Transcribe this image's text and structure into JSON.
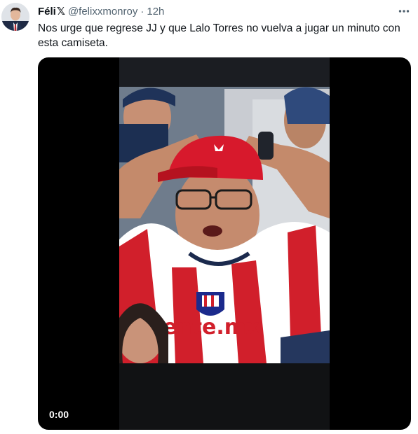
{
  "tweet": {
    "author_name": "Féli",
    "author_badge": "𝕏",
    "handle": "@felixxmonroy",
    "separator": "·",
    "time": "12h",
    "text": "Nos urge que regrese JJ y que Lalo Torres no vuelva a jugar un minuto con esta camiseta.",
    "more_icon": "more-horizontal-icon"
  },
  "video": {
    "timestamp": "0:00",
    "shirt_sponsor": "ente.mx"
  },
  "colors": {
    "text_primary": "#0f1419",
    "text_secondary": "#536471",
    "media_bg": "#000000",
    "shirt_red": "#d11f2b",
    "cap_red": "#d7192c"
  }
}
